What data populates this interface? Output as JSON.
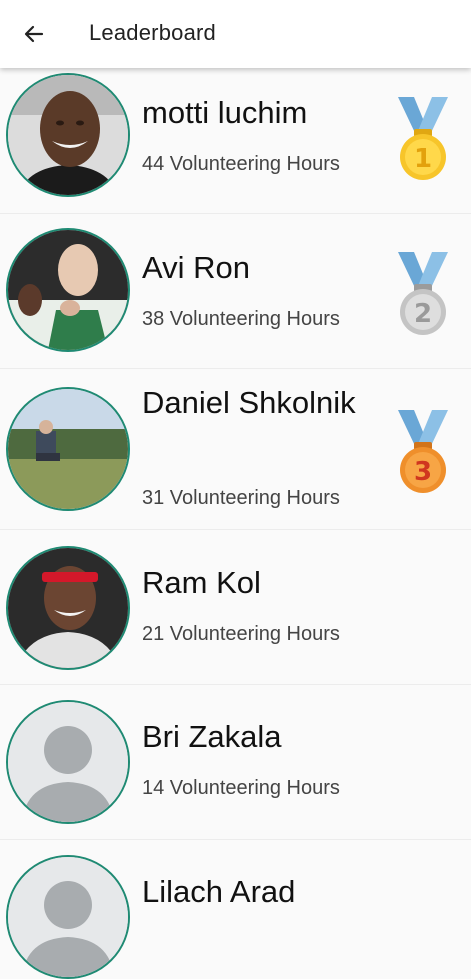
{
  "header": {
    "title": "Leaderboard",
    "back_icon": "arrow-left-icon"
  },
  "colors": {
    "accent": "#1f8a73",
    "gold": "#f7c52a",
    "silver": "#cfcfcf",
    "bronze": "#ef8f2b",
    "ribbon": "#7fb0d6"
  },
  "leaderboard": [
    {
      "name": "motti luchim",
      "hours": "44 Volunteering Hours",
      "medal": "1"
    },
    {
      "name": "Avi Ron",
      "hours": "38 Volunteering Hours",
      "medal": "2"
    },
    {
      "name": "Daniel Shkolnik",
      "hours": "31 Volunteering Hours",
      "medal": "3"
    },
    {
      "name": "Ram Kol",
      "hours": "21 Volunteering Hours",
      "medal": ""
    },
    {
      "name": "Bri Zakala",
      "hours": "14 Volunteering Hours",
      "medal": ""
    },
    {
      "name": "Lilach Arad",
      "hours": "",
      "medal": ""
    }
  ]
}
